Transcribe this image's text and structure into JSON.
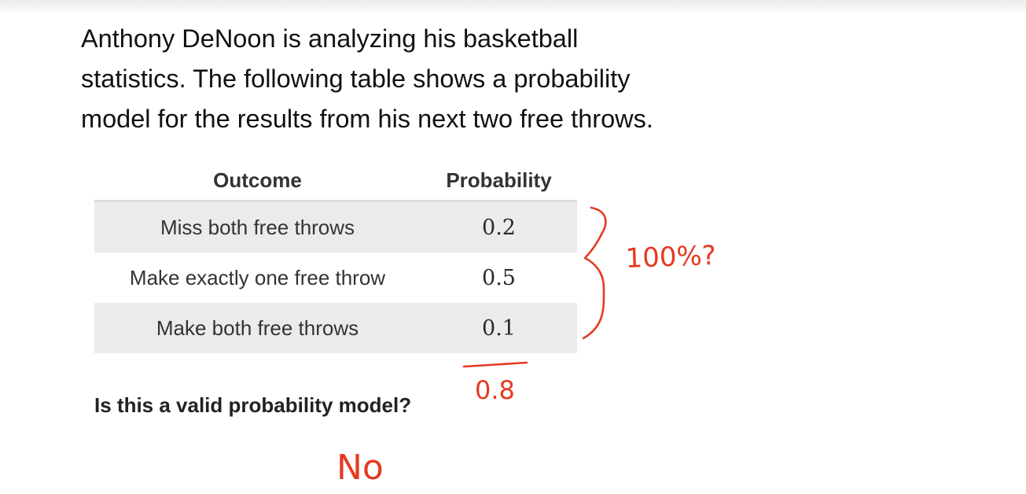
{
  "problem": {
    "lines": [
      "Anthony DeNoon  is analyzing his basketball",
      "statistics. The following table shows a probability",
      "model for the results from his next two free throws."
    ]
  },
  "table": {
    "headers": [
      "Outcome",
      "Probability"
    ],
    "rows": [
      {
        "outcome": "Miss both free throws",
        "probability": "0.2"
      },
      {
        "outcome": "Make exactly one free throw",
        "probability": "0.5"
      },
      {
        "outcome": "Make both free throws",
        "probability": "0.1"
      }
    ]
  },
  "question": "Is this a valid probability model?",
  "annotations": {
    "ink_color": "#e53a22",
    "brace_note": "100%?",
    "sum": "0.8",
    "answer": "No"
  }
}
